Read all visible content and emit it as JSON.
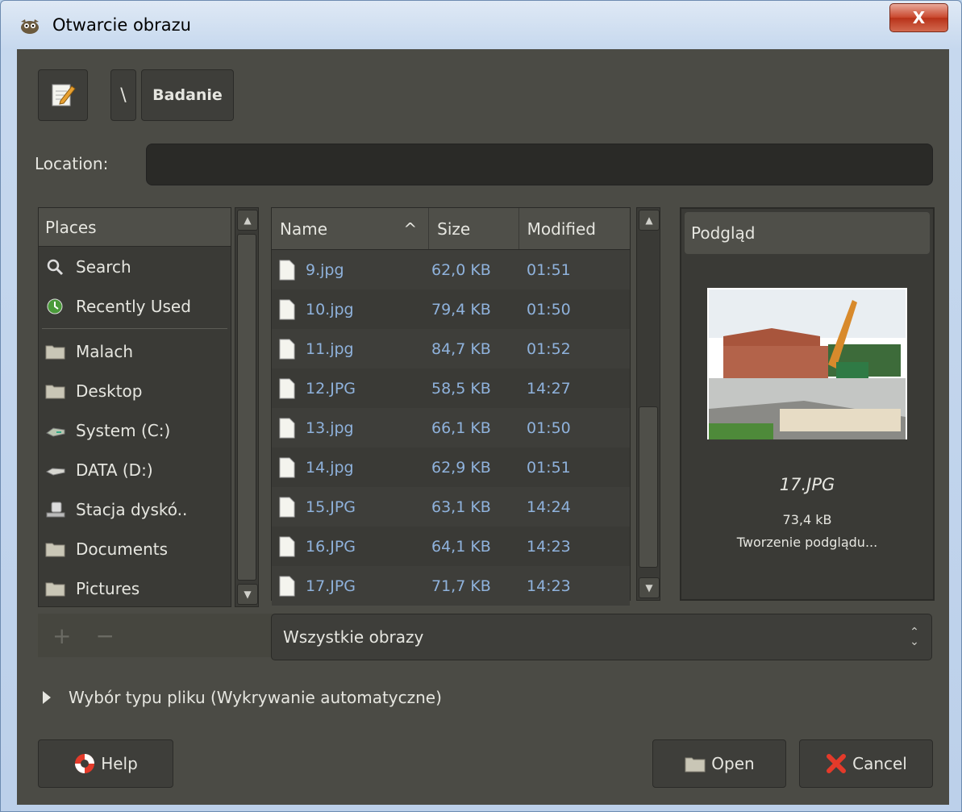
{
  "window": {
    "title": "Otwarcie obrazu",
    "close_label": "X"
  },
  "toolbar": {
    "separator": "\\",
    "crumb": "Badanie"
  },
  "location": {
    "label": "Location:",
    "value": ""
  },
  "places": {
    "header": "Places",
    "items": [
      {
        "label": "Search",
        "icon": "search-icon"
      },
      {
        "label": "Recently Used",
        "icon": "recent-icon"
      },
      {
        "label": "Malach",
        "icon": "folder-icon"
      },
      {
        "label": "Desktop",
        "icon": "folder-icon"
      },
      {
        "label": "System (C:)",
        "icon": "drive-icon"
      },
      {
        "label": "DATA (D:)",
        "icon": "drive-icon"
      },
      {
        "label": "Stacja dyskó..",
        "icon": "network-drive-icon"
      },
      {
        "label": "Documents",
        "icon": "folder-icon"
      },
      {
        "label": "Pictures",
        "icon": "folder-icon"
      }
    ],
    "add": "+",
    "remove": "−"
  },
  "files": {
    "columns": {
      "name": "Name",
      "size": "Size",
      "modified": "Modified"
    },
    "sort_indicator": "^",
    "rows": [
      {
        "name": "9.jpg",
        "size": "62,0 KB",
        "modified": "01:51"
      },
      {
        "name": "10.jpg",
        "size": "79,4 KB",
        "modified": "01:50"
      },
      {
        "name": "11.jpg",
        "size": "84,7 KB",
        "modified": "01:52"
      },
      {
        "name": "12.JPG",
        "size": "58,5 KB",
        "modified": "14:27"
      },
      {
        "name": "13.jpg",
        "size": "66,1 KB",
        "modified": "01:50"
      },
      {
        "name": "14.jpg",
        "size": "62,9 KB",
        "modified": "01:51"
      },
      {
        "name": "15.JPG",
        "size": "63,1 KB",
        "modified": "14:24"
      },
      {
        "name": "16.JPG",
        "size": "64,1 KB",
        "modified": "14:23"
      },
      {
        "name": "17.JPG",
        "size": "71,7 KB",
        "modified": "14:23"
      }
    ]
  },
  "preview": {
    "header": "Podgląd",
    "name": "17.JPG",
    "size": "73,4 kB",
    "status": "Tworzenie podglądu..."
  },
  "filter": {
    "selected": "Wszystkie obrazy"
  },
  "expander": {
    "label": "Wybór typu pliku (Wykrywanie automatyczne)"
  },
  "buttons": {
    "help": "Help",
    "open": "Open",
    "cancel": "Cancel"
  },
  "colors": {
    "background": "#4b4b45",
    "file_text": "#8fb2dc",
    "titlebar": "#c6d8ee"
  }
}
